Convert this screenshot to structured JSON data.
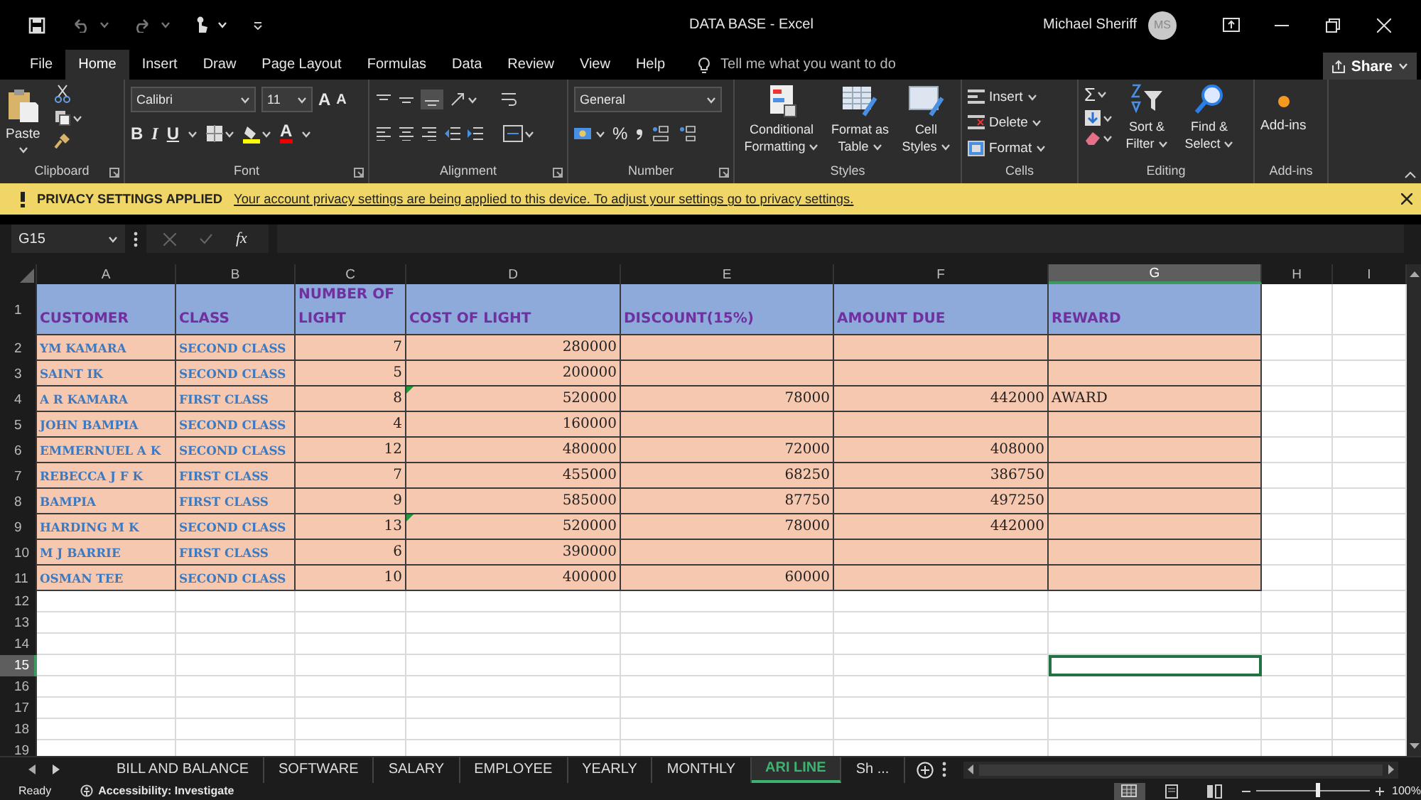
{
  "title_bar": {
    "title": "DATA BASE  -  Excel",
    "user": "Michael Sheriff",
    "avatar": "MS"
  },
  "menu": {
    "tabs": [
      {
        "label": "File",
        "selected": false
      },
      {
        "label": "Home",
        "selected": true
      },
      {
        "label": "Insert",
        "selected": false
      },
      {
        "label": "Draw",
        "selected": false
      },
      {
        "label": "Page Layout",
        "selected": false
      },
      {
        "label": "Formulas",
        "selected": false
      },
      {
        "label": "Data",
        "selected": false
      },
      {
        "label": "Review",
        "selected": false
      },
      {
        "label": "View",
        "selected": false
      },
      {
        "label": "Help",
        "selected": false
      }
    ],
    "tell_me": {
      "placeholder": "Tell me what you want to do"
    },
    "share": "Share"
  },
  "ribbon": {
    "clipboard": {
      "paste": "Paste",
      "label": "Clipboard"
    },
    "font": {
      "name": "Calibri",
      "size": "11",
      "grow": "A",
      "shrink": "A",
      "bold": "B",
      "italic": "I",
      "underline": "U",
      "font_color": "A",
      "label": "Font"
    },
    "alignment": {
      "label": "Alignment"
    },
    "number": {
      "format": "General",
      "percent": "%",
      "label": "Number"
    },
    "styles": {
      "buttons": [
        "Conditional Formatting",
        "Format as Table",
        "Cell Styles"
      ],
      "label": "Styles"
    },
    "cells": {
      "buttons": [
        "Insert",
        "Delete",
        "Format"
      ],
      "label": "Cells"
    },
    "editing": {
      "sum": "Σ",
      "buttons": [
        "Sort & Filter",
        "Find & Select"
      ],
      "label": "Editing"
    },
    "addins": {
      "button": "Add-ins",
      "label": "Add-ins"
    }
  },
  "privacy_bar": {
    "title": "PRIVACY SETTINGS APPLIED",
    "message": "Your account privacy settings are being applied to this device. To adjust your settings go to privacy settings."
  },
  "formula_bar": {
    "name_box": "G15",
    "fx": "fx"
  },
  "sheet": {
    "column_headers": [
      {
        "label": "A",
        "selected": false
      },
      {
        "label": "B",
        "selected": false
      },
      {
        "label": "C",
        "selected": false
      },
      {
        "label": "D",
        "selected": false
      },
      {
        "label": "E",
        "selected": false
      },
      {
        "label": "F",
        "selected": false
      },
      {
        "label": "G",
        "selected": true
      },
      {
        "label": "H",
        "selected": false
      },
      {
        "label": "I",
        "selected": false
      }
    ],
    "row_headers": [
      {
        "label": "1",
        "selected": false
      },
      {
        "label": "2",
        "selected": false
      },
      {
        "label": "3",
        "selected": false
      },
      {
        "label": "4",
        "selected": false
      },
      {
        "label": "5",
        "selected": false
      },
      {
        "label": "6",
        "selected": false
      },
      {
        "label": "7",
        "selected": false
      },
      {
        "label": "8",
        "selected": false
      },
      {
        "label": "9",
        "selected": false
      },
      {
        "label": "10",
        "selected": false
      },
      {
        "label": "11",
        "selected": false
      },
      {
        "label": "12",
        "selected": false
      },
      {
        "label": "13",
        "selected": false
      },
      {
        "label": "14",
        "selected": false
      },
      {
        "label": "15",
        "selected": true
      },
      {
        "label": "16",
        "selected": false
      },
      {
        "label": "17",
        "selected": false
      },
      {
        "label": "18",
        "selected": false
      },
      {
        "label": "19",
        "selected": false
      }
    ],
    "table": {
      "columns": [
        {
          "heading": "CUSTOMER",
          "kind": "text"
        },
        {
          "heading": "CLASS",
          "kind": "text"
        },
        {
          "heading": "NUMBER OF LIGHT",
          "kind": "number"
        },
        {
          "heading": "COST OF LIGHT",
          "kind": "number"
        },
        {
          "heading": "DISCOUNT(15%)",
          "kind": "number"
        },
        {
          "heading": "AMOUNT DUE",
          "kind": "number"
        },
        {
          "heading": "REWARD",
          "kind": "plain"
        }
      ],
      "rows": [
        {
          "cells": [
            "YM KAMARA",
            "SECOND CLASS",
            "7",
            "280000",
            null,
            null,
            null
          ],
          "error_mark": false
        },
        {
          "cells": [
            "SAINT IK",
            "SECOND CLASS",
            "5",
            "200000",
            null,
            null,
            null
          ],
          "error_mark": false
        },
        {
          "cells": [
            "A R KAMARA",
            "FIRST CLASS",
            "8",
            "520000",
            "78000",
            "442000",
            "AWARD"
          ],
          "error_mark": true
        },
        {
          "cells": [
            "JOHN BAMPIA",
            "SECOND CLASS",
            "4",
            "160000",
            null,
            null,
            null
          ],
          "error_mark": false
        },
        {
          "cells": [
            "EMMERNUEL A K",
            "SECOND CLASS",
            "12",
            "480000",
            "72000",
            "408000",
            null
          ],
          "error_mark": false
        },
        {
          "cells": [
            "REBECCA J F K",
            "FIRST CLASS",
            "7",
            "455000",
            "68250",
            "386750",
            null
          ],
          "error_mark": false
        },
        {
          "cells": [
            "BAMPIA",
            "FIRST CLASS",
            "9",
            "585000",
            "87750",
            "497250",
            null
          ],
          "error_mark": false
        },
        {
          "cells": [
            "HARDING M K",
            "SECOND CLASS",
            "13",
            "520000",
            "78000",
            "442000",
            null
          ],
          "error_mark": true
        },
        {
          "cells": [
            "M J BARRIE",
            "FIRST CLASS",
            "6",
            "390000",
            null,
            null,
            null
          ],
          "error_mark": false
        },
        {
          "cells": [
            "OSMAN TEE",
            "SECOND CLASS",
            "10",
            "400000",
            "60000",
            null,
            null
          ],
          "error_mark": false
        }
      ]
    }
  },
  "sheet_tabs": [
    {
      "label": "BILL AND BALANCE",
      "selected": false
    },
    {
      "label": "SOFTWARE",
      "selected": false
    },
    {
      "label": "SALARY",
      "selected": false
    },
    {
      "label": "EMPLOYEE",
      "selected": false
    },
    {
      "label": "YEARLY",
      "selected": false
    },
    {
      "label": "MONTHLY",
      "selected": false
    },
    {
      "label": "ARI LINE",
      "selected": true
    },
    {
      "label": "Sh ...",
      "selected": false
    }
  ],
  "status_bar": {
    "ready": "Ready",
    "accessibility": "Accessibility: Investigate",
    "views": [
      {
        "kind": "normal",
        "selected": true
      },
      {
        "kind": "layout",
        "selected": false
      },
      {
        "kind": "break",
        "selected": false
      }
    ],
    "zoom": {
      "level": 0.55
    },
    "zoom_percent": "100%"
  }
}
